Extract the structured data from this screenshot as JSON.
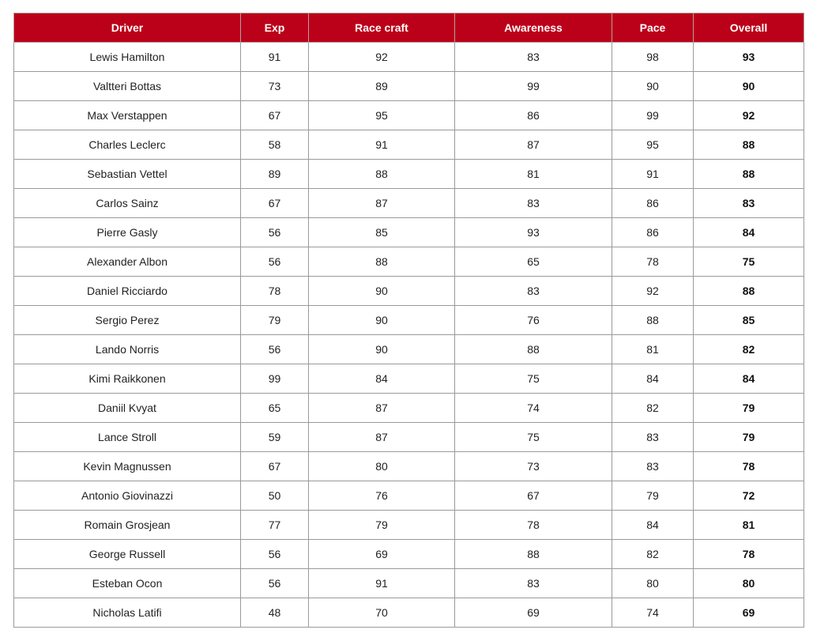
{
  "header": {
    "accent_color": "#bb0019",
    "columns": [
      "Driver",
      "Exp",
      "Race craft",
      "Awareness",
      "Pace",
      "Overall"
    ]
  },
  "rows": [
    [
      "Lewis Hamilton",
      "91",
      "92",
      "83",
      "98",
      "93"
    ],
    [
      "Valtteri Bottas",
      "73",
      "89",
      "99",
      "90",
      "90"
    ],
    [
      "Max Verstappen",
      "67",
      "95",
      "86",
      "99",
      "92"
    ],
    [
      "Charles Leclerc",
      "58",
      "91",
      "87",
      "95",
      "88"
    ],
    [
      "Sebastian Vettel",
      "89",
      "88",
      "81",
      "91",
      "88"
    ],
    [
      "Carlos Sainz",
      "67",
      "87",
      "83",
      "86",
      "83"
    ],
    [
      "Pierre Gasly",
      "56",
      "85",
      "93",
      "86",
      "84"
    ],
    [
      "Alexander Albon",
      "56",
      "88",
      "65",
      "78",
      "75"
    ],
    [
      "Daniel Ricciardo",
      "78",
      "90",
      "83",
      "92",
      "88"
    ],
    [
      "Sergio Perez",
      "79",
      "90",
      "76",
      "88",
      "85"
    ],
    [
      "Lando Norris",
      "56",
      "90",
      "88",
      "81",
      "82"
    ],
    [
      "Kimi Raikkonen",
      "99",
      "84",
      "75",
      "84",
      "84"
    ],
    [
      "Daniil Kvyat",
      "65",
      "87",
      "74",
      "82",
      "79"
    ],
    [
      "Lance Stroll",
      "59",
      "87",
      "75",
      "83",
      "79"
    ],
    [
      "Kevin Magnussen",
      "67",
      "80",
      "73",
      "83",
      "78"
    ],
    [
      "Antonio Giovinazzi",
      "50",
      "76",
      "67",
      "79",
      "72"
    ],
    [
      "Romain Grosjean",
      "77",
      "79",
      "78",
      "84",
      "81"
    ],
    [
      "George Russell",
      "56",
      "69",
      "88",
      "82",
      "78"
    ],
    [
      "Esteban Ocon",
      "56",
      "91",
      "83",
      "80",
      "80"
    ],
    [
      "Nicholas Latifi",
      "48",
      "70",
      "69",
      "74",
      "69"
    ]
  ]
}
